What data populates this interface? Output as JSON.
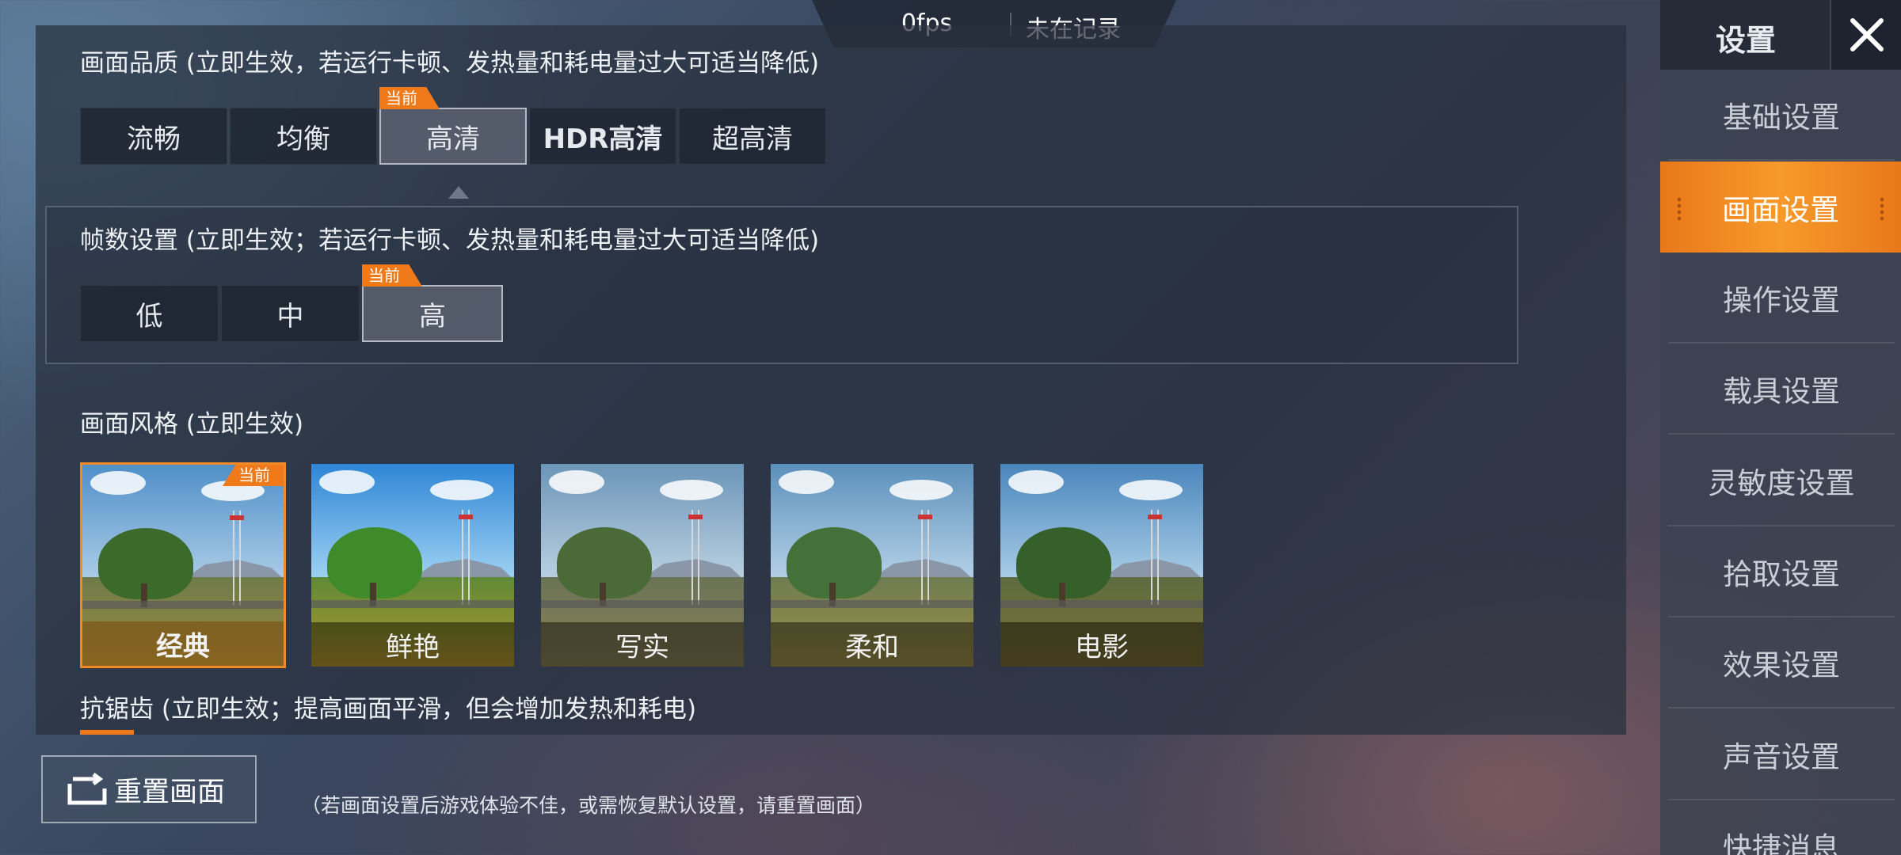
{
  "topbar": {
    "fps": "0fps",
    "recording": "未在记录"
  },
  "quality": {
    "title": "画面品质 (立即生效，若运行卡顿、发热量和耗电量过大可适当降低)",
    "current_tag": "当前",
    "options": [
      "流畅",
      "均衡",
      "高清",
      "HDR高清",
      "超高清"
    ],
    "selected": "高清"
  },
  "framerate": {
    "title": "帧数设置 (立即生效；若运行卡顿、发热量和耗电量过大可适当降低)",
    "current_tag": "当前",
    "options": [
      "低",
      "中",
      "高"
    ],
    "selected": "高"
  },
  "style": {
    "title": "画面风格 (立即生效)",
    "current_tag": "当前",
    "options": [
      "经典",
      "鲜艳",
      "写实",
      "柔和",
      "电影"
    ],
    "selected": "经典"
  },
  "antialias": {
    "title": "抗锯齿 (立即生效；提高画面平滑，但会增加发热和耗电)"
  },
  "reset": {
    "label": "重置画面",
    "hint": "（若画面设置后游戏体验不佳，或需恢复默认设置，请重置画面）"
  },
  "sidebar": {
    "title": "设置",
    "items": [
      "基础设置",
      "画面设置",
      "操作设置",
      "载具设置",
      "灵敏度设置",
      "拾取设置",
      "效果设置",
      "声音设置",
      "快捷消息"
    ],
    "active": "画面设置"
  },
  "colors": {
    "accent": "#f07a1a",
    "panel": "#28303e"
  },
  "icons": {
    "close": "close-icon",
    "reset": "reset-icon"
  }
}
